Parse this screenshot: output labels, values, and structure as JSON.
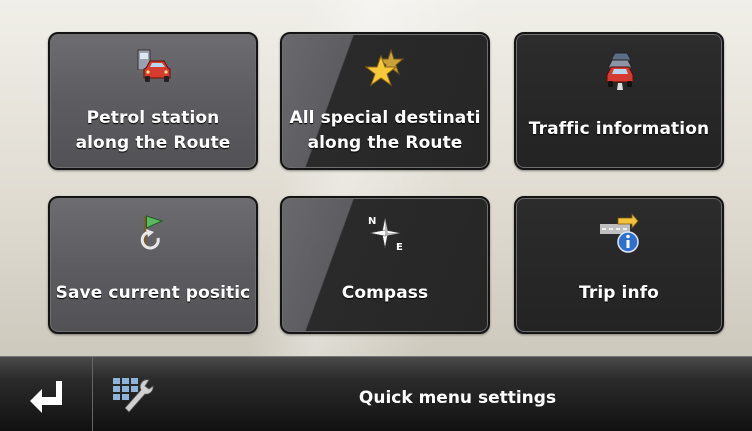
{
  "tiles": [
    {
      "line1": "Petrol station",
      "line2": "along the Route",
      "icon": "petrol-station-car-icon"
    },
    {
      "line1": "All special destinati",
      "line2": "along the Route",
      "icon": "stars-icon"
    },
    {
      "line1": "Traffic information",
      "icon": "traffic-jam-icon"
    },
    {
      "line1": "Save current positic",
      "icon": "flag-save-icon"
    },
    {
      "line1": "Compass",
      "icon": "compass-icon",
      "compass_n": "N",
      "compass_e": "E"
    },
    {
      "line1": "Trip info",
      "icon": "trip-info-icon"
    }
  ],
  "toolbar": {
    "back_icon": "return-arrow-icon",
    "settings_icon": "grid-wrench-icon",
    "settings_label": "Quick menu settings"
  }
}
